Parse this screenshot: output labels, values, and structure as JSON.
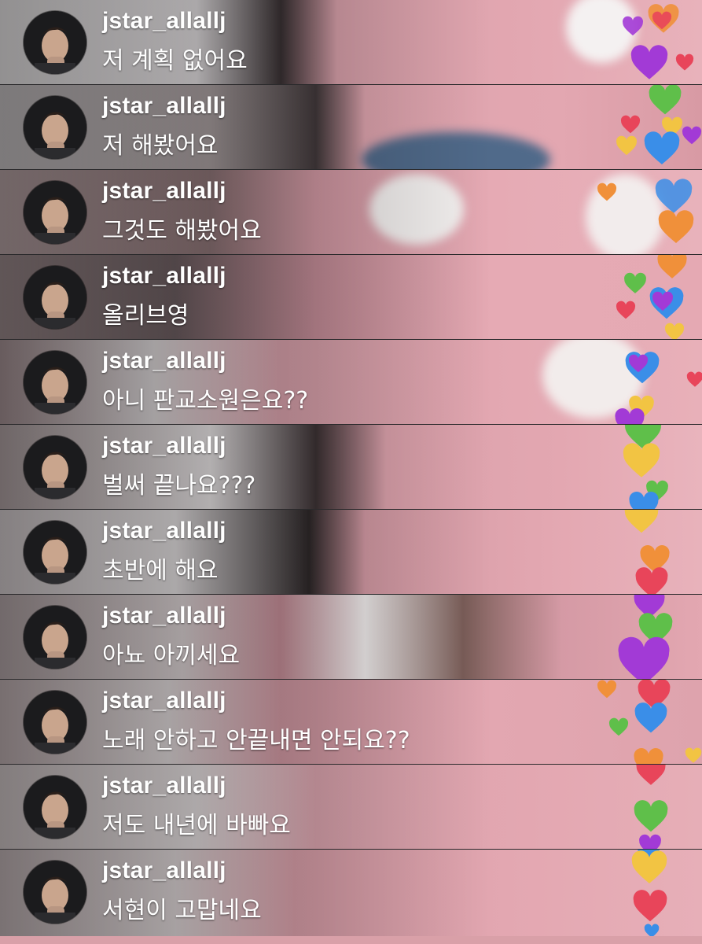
{
  "comments": [
    {
      "username": "jstar_allallj",
      "message": "저 계획 없어요"
    },
    {
      "username": "jstar_allallj",
      "message": "저 해봤어요"
    },
    {
      "username": "jstar_allallj",
      "message": "그것도 해봤어요"
    },
    {
      "username": "jstar_allallj",
      "message": "올리브영"
    },
    {
      "username": "jstar_allallj",
      "message": "아니 판교소원은요??"
    },
    {
      "username": "jstar_allallj",
      "message": "벌써 끝나요???"
    },
    {
      "username": "jstar_allallj",
      "message": "초반에 해요"
    },
    {
      "username": "jstar_allallj",
      "message": "아뇨 아끼세요"
    },
    {
      "username": "jstar_allallj",
      "message": "노래 안하고 안끝내면 안되요??"
    },
    {
      "username": "jstar_allallj",
      "message": "저도 내년에 바빠요"
    },
    {
      "username": "jstar_allallj",
      "message": "서현이 고맙네요"
    }
  ],
  "colors": {
    "sweater_pink": "#e3a7b1",
    "heart_purple": "#a23ad6",
    "heart_green": "#5fbf4a",
    "heart_red": "#e8455a",
    "heart_orange": "#f0903a",
    "heart_yellow": "#f2c443",
    "heart_blue": "#3a8ee8"
  }
}
